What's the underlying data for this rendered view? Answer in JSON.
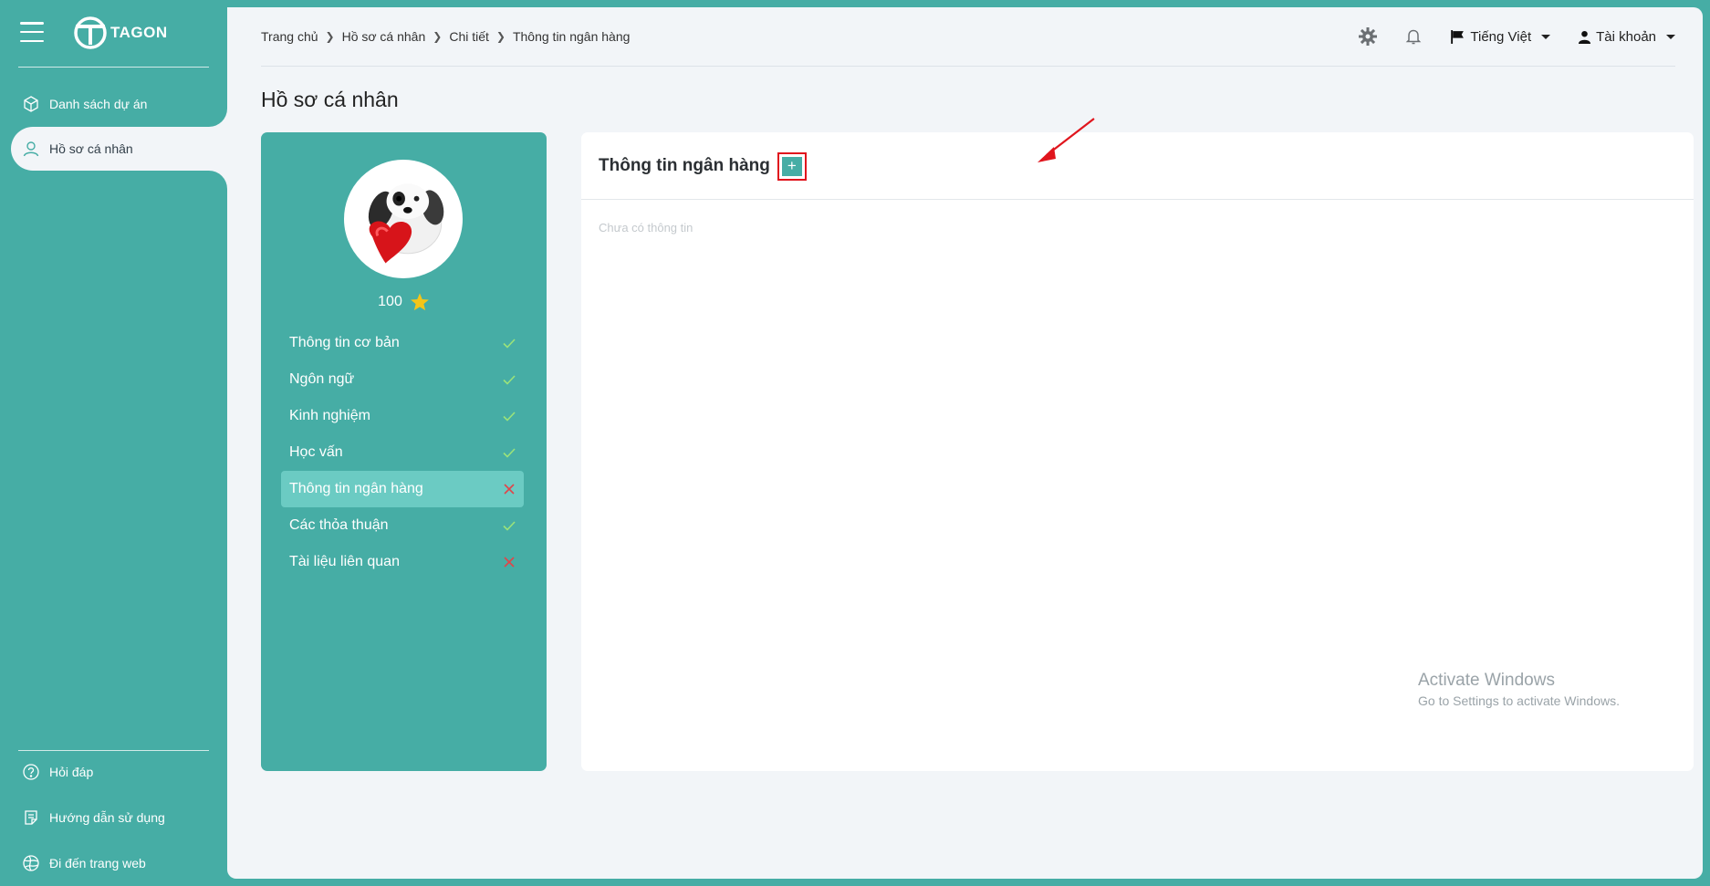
{
  "app": {
    "logo_text": "TAGON"
  },
  "sidebar": {
    "items": [
      {
        "label": "Danh sách dự án",
        "icon": "cube-icon"
      },
      {
        "label": "Hồ sơ cá nhân",
        "icon": "user-icon"
      }
    ],
    "footer_items": [
      {
        "label": "Hỏi đáp",
        "icon": "question-circle-icon"
      },
      {
        "label": "Hướng dẫn sử dụng",
        "icon": "document-icon"
      },
      {
        "label": "Đi đến trang web",
        "icon": "globe-icon"
      }
    ]
  },
  "breadcrumb": [
    "Trang chủ",
    "Hồ sơ cá nhân",
    "Chi tiết",
    "Thông tin ngân hàng"
  ],
  "topbar": {
    "language": "Tiếng Việt",
    "account": "Tài khoản"
  },
  "page": {
    "title": "Hồ sơ cá nhân"
  },
  "profile": {
    "score": "100",
    "sections": [
      {
        "label": "Thông tin cơ bản",
        "complete": true
      },
      {
        "label": "Ngôn ngữ",
        "complete": true
      },
      {
        "label": "Kinh nghiệm",
        "complete": true
      },
      {
        "label": "Học vấn",
        "complete": true
      },
      {
        "label": "Thông tin ngân hàng",
        "complete": false
      },
      {
        "label": "Các thỏa thuận",
        "complete": true
      },
      {
        "label": "Tài liệu liên quan",
        "complete": false
      }
    ]
  },
  "bank_card": {
    "title": "Thông tin ngân hàng",
    "add_label": "+",
    "empty_text": "Chưa có thông tin"
  },
  "watermark": {
    "title": "Activate Windows",
    "subtitle": "Go to Settings to activate Windows."
  },
  "colors": {
    "brand": "#46ADA5",
    "active_row": "#6BCBC3",
    "check": "#9BE37A",
    "cross": "#E0454A",
    "highlight": "#E0151D",
    "star": "#F5C518"
  }
}
